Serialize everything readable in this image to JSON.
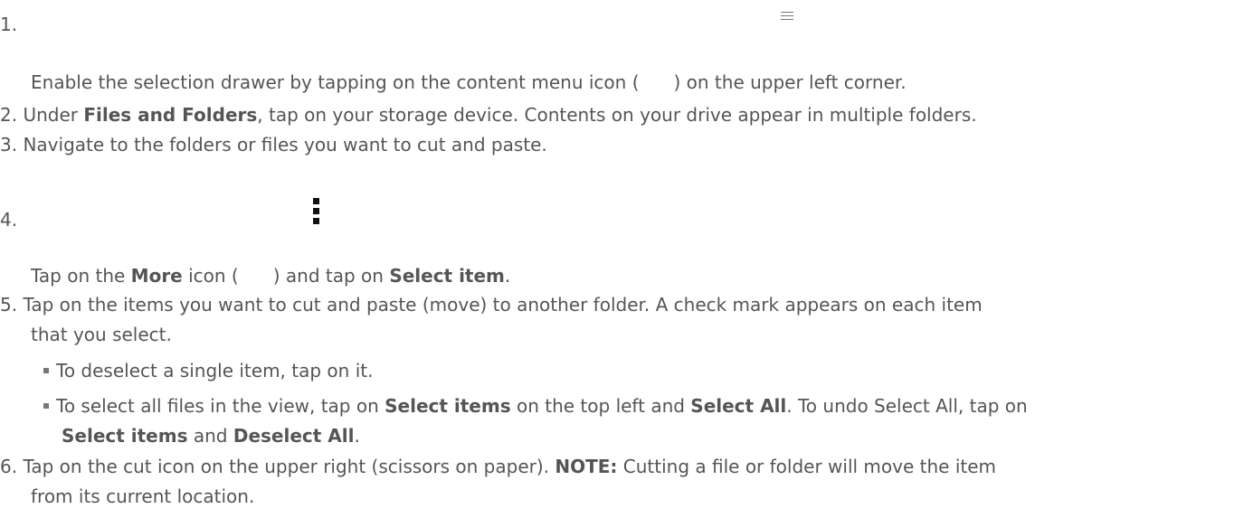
{
  "steps": [
    {
      "number": "1.",
      "text_before": "Enable the selection drawer by tapping on the content menu icon (",
      "text_after": ") on the upper left corner."
    },
    {
      "number": "2.",
      "text_before": "Under ",
      "bold": "Files and Folders",
      "text_after": ", tap on your storage device. Contents on your drive appear in multiple folders."
    },
    {
      "number": "3.",
      "text": "Navigate to the folders or files you want to cut and paste."
    },
    {
      "number": "4.",
      "text_before": "Tap on the ",
      "bold1": "More",
      "text_mid": " icon (",
      "text_mid2": ") and tap on ",
      "bold2": "Select item",
      "text_after": "."
    },
    {
      "number": "5.",
      "line1": "Tap on the items you want to cut and paste (move) to another folder. A check mark appears on each item",
      "line2": "that you select.",
      "bullets": [
        {
          "text": "To deselect a single item, tap on it."
        },
        {
          "t1": "To select all files in the view, tap on ",
          "b1": "Select items",
          "t2": " on the top left and ",
          "b2": "Select All",
          "t3": ". To undo Select All, tap on",
          "b3": "Select items",
          "t4": " and ",
          "b4": "Deselect All",
          "t5": "."
        }
      ]
    },
    {
      "number": "6.",
      "text_before": "Tap on the cut icon on the upper right (scissors on paper). ",
      "bold": "NOTE:",
      "text_after": " Cutting a file or folder will move the item",
      "line2": "from its current location."
    }
  ],
  "icons": {
    "content_menu": "hamburger-menu-icon",
    "more": "vertical-more-icon"
  }
}
